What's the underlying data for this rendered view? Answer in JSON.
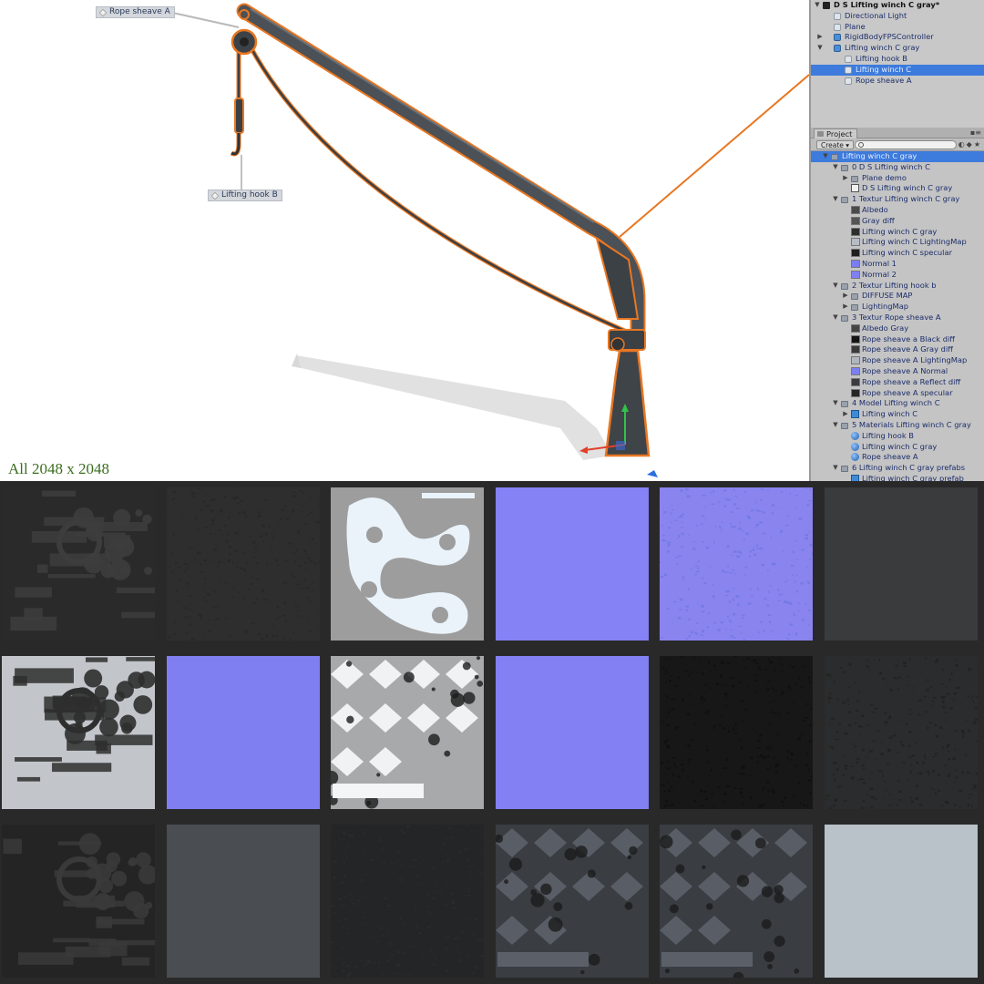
{
  "scene": {
    "labels": {
      "rope_sheave": "Rope sheave A",
      "lifting_hook": "Lifting hook B"
    },
    "caption": "All 2048 x 2048",
    "colors": {
      "selection_outline": "#e87722",
      "crane_body": "#4b5156"
    }
  },
  "hierarchy": {
    "scene_title": "D S Lifting winch C gray*",
    "items": [
      {
        "label": "Directional Light",
        "depth": 1,
        "icon": "gameobject-icon",
        "arrow": ""
      },
      {
        "label": "Plane",
        "depth": 1,
        "icon": "gameobject-icon",
        "arrow": ""
      },
      {
        "label": "RigidBodyFPSController",
        "depth": 1,
        "icon": "prefab-icon",
        "arrow": "right"
      },
      {
        "label": "Lifting winch C gray",
        "depth": 1,
        "icon": "prefab-icon",
        "arrow": "down"
      },
      {
        "label": "Lifting hook B",
        "depth": 2,
        "icon": "gameobject-icon",
        "arrow": ""
      },
      {
        "label": "Lifting winch C",
        "depth": 2,
        "icon": "gameobject-icon",
        "arrow": "",
        "selected": true
      },
      {
        "label": "Rope sheave A",
        "depth": 2,
        "icon": "gameobject-icon",
        "arrow": ""
      }
    ]
  },
  "project": {
    "tab_label": "Project",
    "create_label": "Create",
    "search_placeholder": "",
    "items": [
      {
        "label": "Lifting winch C gray",
        "depth": 0,
        "type": "folder",
        "arrow": "down",
        "selected": true
      },
      {
        "label": "0 D S Lifting winch C",
        "depth": 1,
        "type": "folder",
        "arrow": "down"
      },
      {
        "label": "Plane demo",
        "depth": 2,
        "type": "folder",
        "arrow": "right"
      },
      {
        "label": "D S Lifting winch C gray",
        "depth": 2,
        "type": "scene",
        "arrow": ""
      },
      {
        "label": "1 Textur Lifting winch C gray",
        "depth": 1,
        "type": "folder",
        "arrow": "down"
      },
      {
        "label": "Albedo",
        "depth": 2,
        "type": "texture",
        "swatch": "#4a4a4a"
      },
      {
        "label": "Gray diff",
        "depth": 2,
        "type": "texture",
        "swatch": "#555555"
      },
      {
        "label": "Lifting winch C gray",
        "depth": 2,
        "type": "texture",
        "swatch": "#2f2f2f"
      },
      {
        "label": "Lifting winch C LightingMap",
        "depth": 2,
        "type": "texture",
        "swatch": "#b8bcc4"
      },
      {
        "label": "Lifting winch C specular",
        "depth": 2,
        "type": "texture",
        "swatch": "#1f1f1f"
      },
      {
        "label": "Normal 1",
        "depth": 2,
        "type": "texture",
        "swatch": "#7a7df2"
      },
      {
        "label": "Normal 2",
        "depth": 2,
        "type": "texture",
        "swatch": "#8080f5"
      },
      {
        "label": "2 Textur Lifting hook b",
        "depth": 1,
        "type": "folder",
        "arrow": "down"
      },
      {
        "label": "DIFFUSE MAP",
        "depth": 2,
        "type": "folder",
        "arrow": "right"
      },
      {
        "label": "LightingMap",
        "depth": 2,
        "type": "folder",
        "arrow": "right"
      },
      {
        "label": "3 Textur Rope sheave A",
        "depth": 1,
        "type": "folder",
        "arrow": "down"
      },
      {
        "label": "Albedo Gray",
        "depth": 2,
        "type": "texture",
        "swatch": "#454545"
      },
      {
        "label": "Rope sheave a Black diff",
        "depth": 2,
        "type": "texture",
        "swatch": "#141414"
      },
      {
        "label": "Rope sheave A Gray diff",
        "depth": 2,
        "type": "texture",
        "swatch": "#3a3a3a"
      },
      {
        "label": "Rope sheave A LightingMap",
        "depth": 2,
        "type": "texture",
        "swatch": "#b0b6be"
      },
      {
        "label": "Rope sheave A Normal",
        "depth": 2,
        "type": "texture",
        "swatch": "#7b7ff0"
      },
      {
        "label": "Rope sheave a Reflect diff",
        "depth": 2,
        "type": "texture",
        "swatch": "#3c3c40"
      },
      {
        "label": "Rope sheave A specular",
        "depth": 2,
        "type": "texture",
        "swatch": "#262626"
      },
      {
        "label": "4 Model Lifting winch C",
        "depth": 1,
        "type": "folder",
        "arrow": "down"
      },
      {
        "label": "Lifting winch C",
        "depth": 2,
        "type": "prefab",
        "arrow": "right"
      },
      {
        "label": "5 Materials  Lifting winch C gray",
        "depth": 1,
        "type": "folder",
        "arrow": "down"
      },
      {
        "label": "Lifting hook B",
        "depth": 2,
        "type": "material"
      },
      {
        "label": "Lifting winch C gray",
        "depth": 2,
        "type": "material"
      },
      {
        "label": "Rope sheave A",
        "depth": 2,
        "type": "material"
      },
      {
        "label": "6 Lifting winch C gray prefabs",
        "depth": 1,
        "type": "folder",
        "arrow": "down"
      },
      {
        "label": "Lifting winch C gray prefab",
        "depth": 2,
        "type": "prefab"
      }
    ]
  },
  "textures": {
    "background": "#292929",
    "rows": [
      [
        {
          "kind": "albedo-atlas",
          "base": "#2a2a2a",
          "fg": "#3d3d3d"
        },
        {
          "kind": "noise",
          "base": "#2e2e2e",
          "fg": "#262626"
        },
        {
          "kind": "s-shape",
          "base": "#9d9d9d",
          "fg": "#eaf3fa"
        },
        {
          "kind": "flat",
          "base": "#8482f4"
        },
        {
          "kind": "noise",
          "base": "#8a84ee",
          "fg": "#6c78e0"
        },
        {
          "kind": "flat",
          "base": "#3a3b3d"
        }
      ],
      [
        {
          "kind": "albedo-atlas",
          "base": "#c2c6cb",
          "fg": "#2e2e2e"
        },
        {
          "kind": "flat",
          "base": "#7f7ff2"
        },
        {
          "kind": "parts-atlas",
          "base": "#a7a9ab",
          "fg": "#f3f5f7"
        },
        {
          "kind": "flat",
          "base": "#8280f3"
        },
        {
          "kind": "noise",
          "base": "#171717",
          "fg": "#0e0e0e"
        },
        {
          "kind": "noise",
          "base": "#2b2c2d",
          "fg": "#1f1f1f"
        }
      ],
      [
        {
          "kind": "albedo-atlas",
          "base": "#242424",
          "fg": "#3a3a3a"
        },
        {
          "kind": "flat",
          "base": "#4a4d51"
        },
        {
          "kind": "noise",
          "base": "#242526",
          "fg": "#2c2c2d"
        },
        {
          "kind": "parts-atlas",
          "base": "#3a3d42",
          "fg": "#5b6068"
        },
        {
          "kind": "parts-atlas",
          "base": "#3a3d42",
          "fg": "#5b6068"
        },
        {
          "kind": "flat",
          "base": "#b9c2c9"
        }
      ]
    ]
  }
}
